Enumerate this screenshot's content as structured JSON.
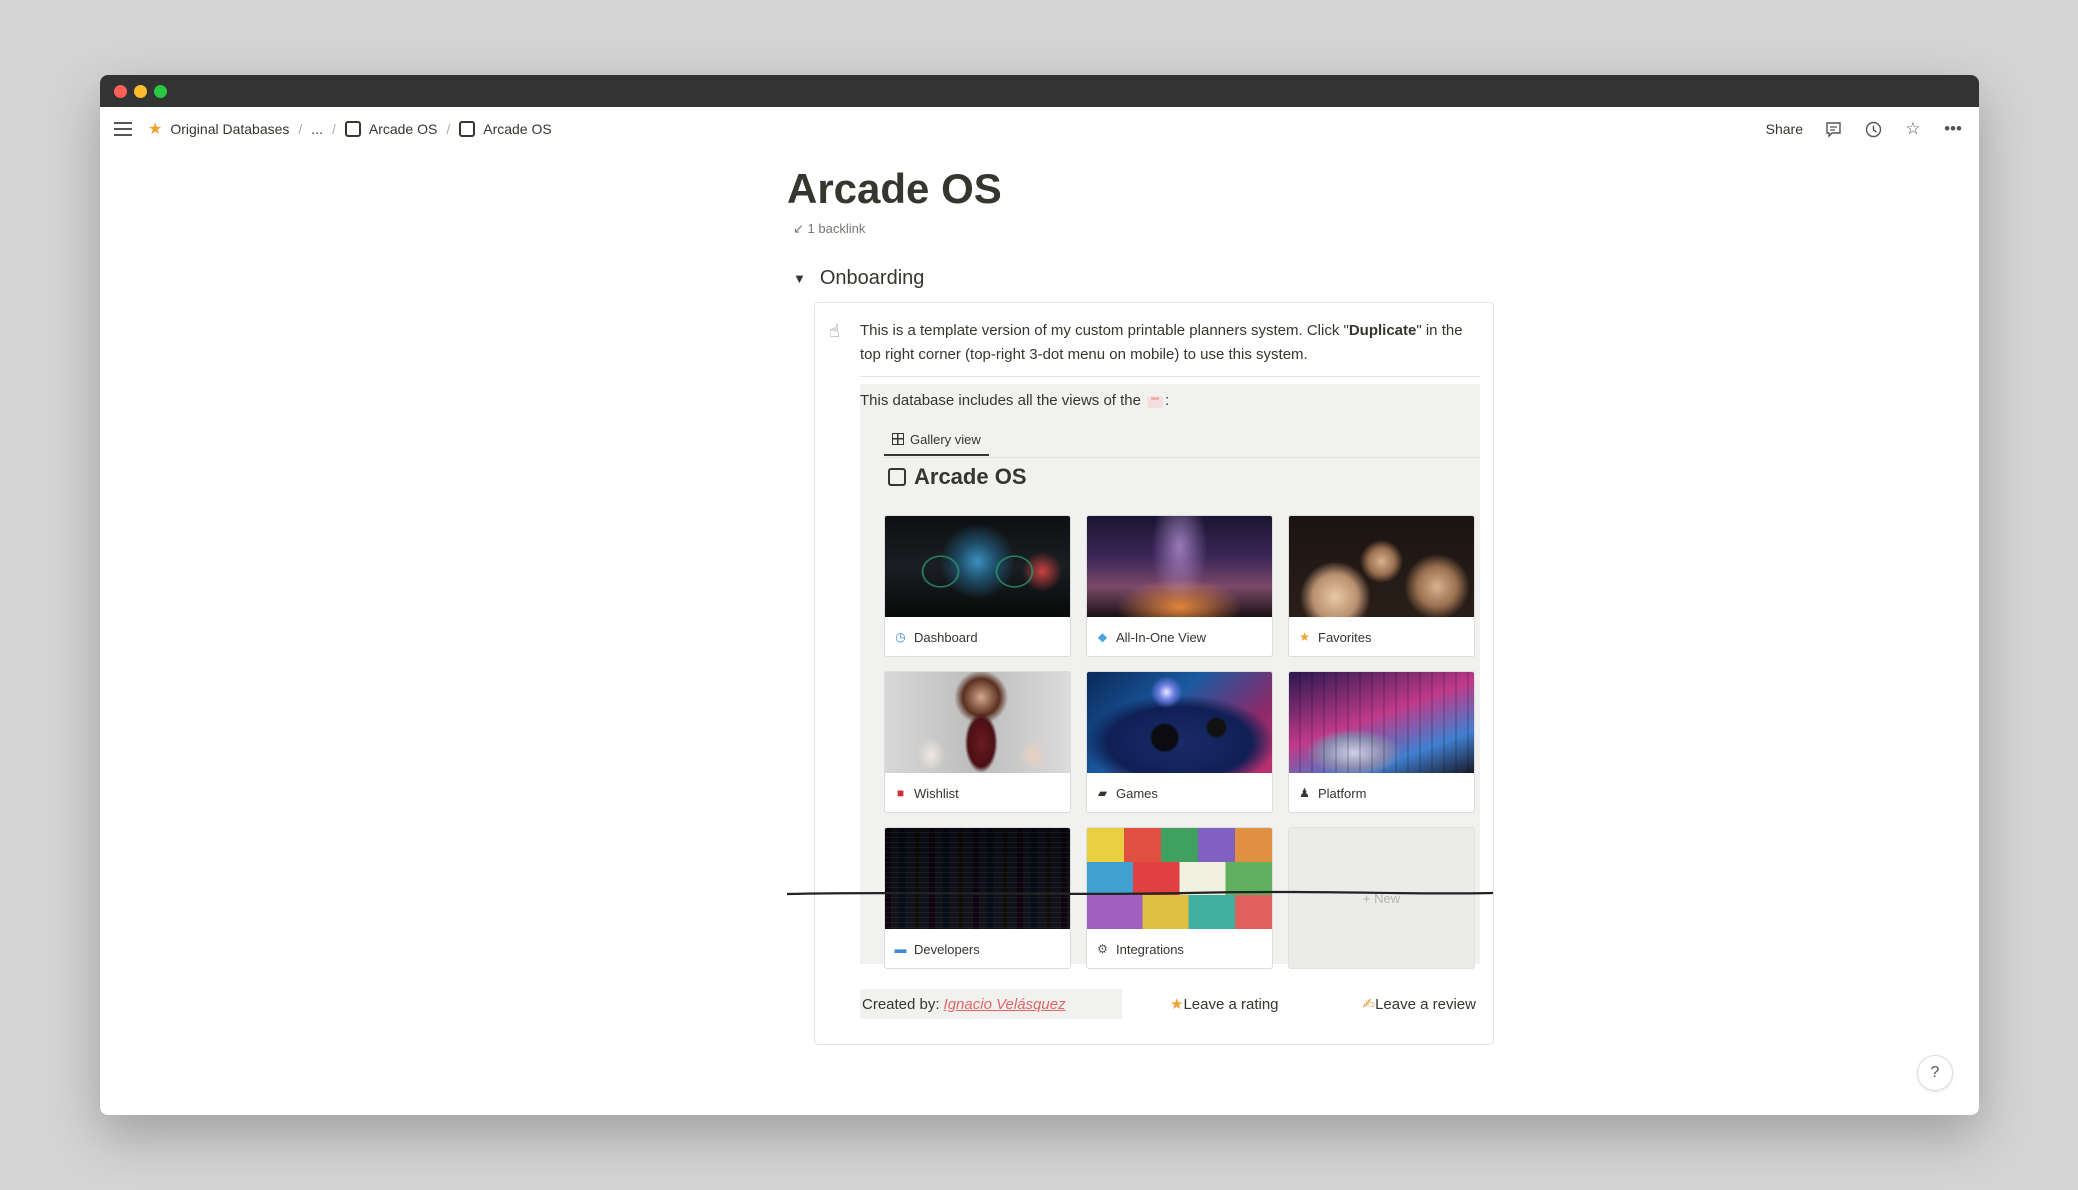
{
  "breadcrumb": {
    "items": [
      "Original Databases",
      "...",
      "Arcade OS",
      "Arcade OS"
    ]
  },
  "topbar": {
    "share_label": "Share"
  },
  "page": {
    "title": "Arcade OS",
    "backlink": "1 backlink",
    "toggle_label": "Onboarding"
  },
  "callout": {
    "intro_part1": "This is a template version of my custom printable planners system.  Click \"",
    "intro_bold1": "Duplicate",
    "intro_part2": "\" in the top right corner (top-right 3-dot menu on mobile) to use this system.",
    "db_text_before": "This database includes all the views of the ",
    "db_text_chip": "\"\"",
    "db_text_after": ":",
    "tab_label": "Gallery view",
    "db_title": "Arcade OS"
  },
  "gallery": {
    "cards": [
      {
        "label": "Dashboard",
        "icon": "speedometer-icon"
      },
      {
        "label": "All-In-One View",
        "icon": "gem-icon"
      },
      {
        "label": "Favorites",
        "icon": "star-icon"
      },
      {
        "label": "Wishlist",
        "icon": "shopping-bags-icon"
      },
      {
        "label": "Games",
        "icon": "gamepad-icon"
      },
      {
        "label": "Platform",
        "icon": "joystick-icon"
      },
      {
        "label": "Developers",
        "icon": "monitor-icon"
      },
      {
        "label": "Integrations",
        "icon": "gear-icon"
      }
    ],
    "new_label": "+ New"
  },
  "footer": {
    "created_by_label": "Created by:",
    "author": "Ignacio Velásquez",
    "rating_label": "Leave a rating",
    "review_label": "Leave a review"
  },
  "help_label": "?",
  "colors": {
    "accent_red": "#e06666",
    "star_orange": "#f0a030",
    "titlebar": "#333333"
  }
}
